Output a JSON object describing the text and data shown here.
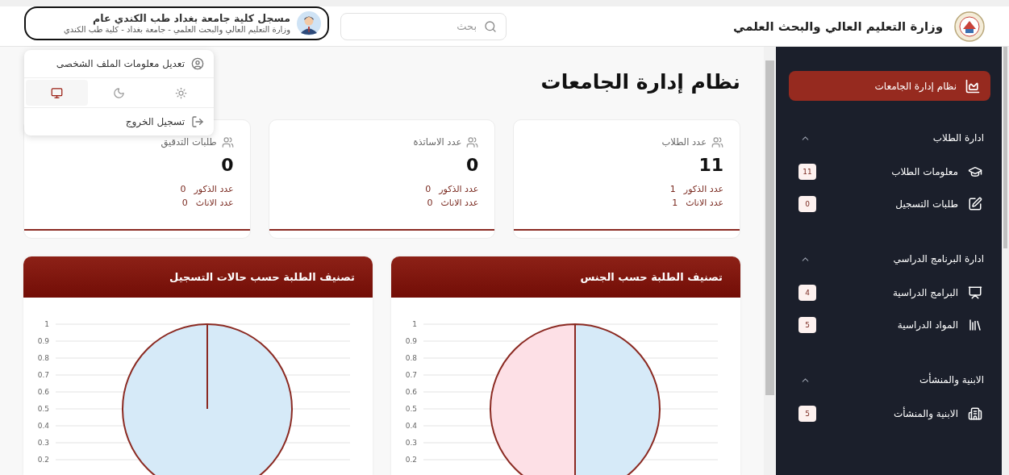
{
  "header": {
    "ministry": "وزارة التعليم العالي والبحث العلمي",
    "search": {
      "placeholder": "بحث"
    },
    "user": {
      "name": "مسجل كلية جامعة بغداد طب الكندي عام",
      "org": "وزارة التعليم العالي والبحث العلمي - جامعة بغداد - كلية طب الكندي"
    }
  },
  "user_menu": {
    "edit_profile": "تعديل معلومات الملف الشخصى",
    "themes": [
      {
        "kind": "light",
        "selected": false
      },
      {
        "kind": "dark",
        "selected": false
      },
      {
        "kind": "system",
        "selected": true
      }
    ],
    "logout": "تسجيل الخروج"
  },
  "page_title": "نظام إدارة الجامعات",
  "stats": [
    {
      "title": "عدد الطلاب",
      "value": "11",
      "rows": [
        {
          "label": "عدد الذكور",
          "value": "1"
        },
        {
          "label": "عدد الاناث",
          "value": "1"
        }
      ]
    },
    {
      "title": "عدد الاساتذة",
      "value": "0",
      "rows": [
        {
          "label": "عدد الذكور",
          "value": "0"
        },
        {
          "label": "عدد الاناث",
          "value": "0"
        }
      ]
    },
    {
      "title": "طلبات التدقيق",
      "value": "0",
      "rows": [
        {
          "label": "عدد الذكور",
          "value": "0"
        },
        {
          "label": "عدد الاناث",
          "value": "0"
        }
      ]
    }
  ],
  "charts": [
    {
      "title": "تصنيف الطلبة حسب الجنس",
      "axis_labels": [
        "1",
        "0.9",
        "0.8",
        "0.7",
        "0.6",
        "0.5",
        "0.4",
        "0.3",
        "0.2"
      ],
      "chart_data": {
        "type": "pie",
        "values": [
          50,
          50
        ]
      }
    },
    {
      "title": "تصنيف الطلبة حسب حالات التسجيل",
      "axis_labels": [
        "1",
        "0.9",
        "0.8",
        "0.7",
        "0.6",
        "0.5",
        "0.4",
        "0.3",
        "0.2"
      ],
      "chart_data": {
        "type": "pie",
        "values": [
          100
        ]
      }
    }
  ],
  "sidebar": {
    "active": {
      "label": "نظام إدارة الجامعات",
      "selected": true
    },
    "groups": [
      {
        "title": "ادارة الطلاب",
        "expanded": true,
        "items": [
          {
            "kind": "students",
            "label": "معلومات الطلاب",
            "count": "11"
          },
          {
            "kind": "registration",
            "label": "طلبات التسجيل",
            "count": "0"
          }
        ]
      },
      {
        "title": "ادارة البرنامج الدراسي",
        "expanded": true,
        "items": [
          {
            "kind": "programs",
            "label": "البرامج الدراسية",
            "count": "4"
          },
          {
            "kind": "subjects",
            "label": "المواد الدراسية",
            "count": "5"
          }
        ]
      },
      {
        "title": "الابنية والمنشأت",
        "expanded": true,
        "items": [
          {
            "kind": "buildings",
            "label": "الابنية والمنشأت",
            "count": "5"
          }
        ]
      }
    ]
  }
}
